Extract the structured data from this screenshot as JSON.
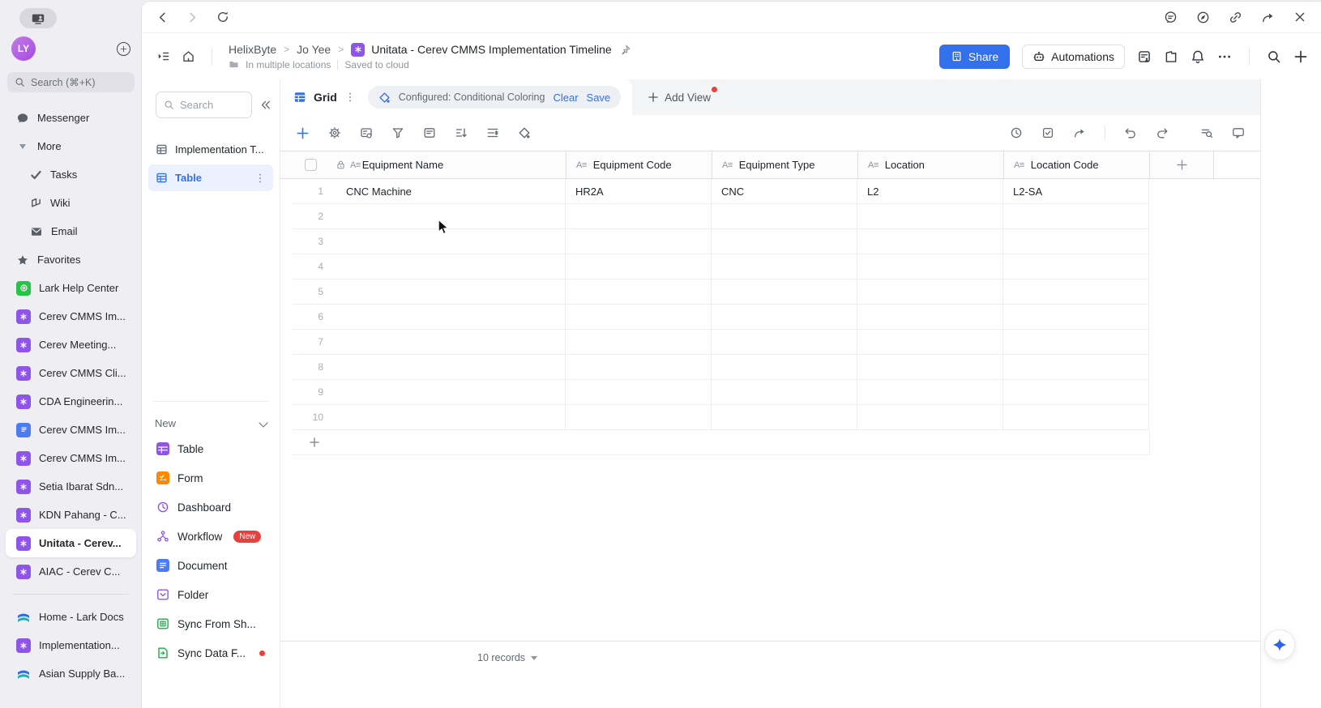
{
  "os_sidebar": {
    "avatar_initials": "LY",
    "search_placeholder": "Search (⌘+K)",
    "messenger_label": "Messenger",
    "more_label": "More",
    "more_subitems": [
      {
        "label": "Tasks",
        "icon": "check-icon"
      },
      {
        "label": "Wiki",
        "icon": "wiki-icon"
      },
      {
        "label": "Email",
        "icon": "mail-icon"
      }
    ],
    "sections": [
      {
        "label": "Favorites",
        "icon": "star-icon",
        "color": "gray"
      },
      {
        "label": "Lark Help Center",
        "icon": "help-icon",
        "color": "green"
      },
      {
        "label": "Cerev CMMS Im...",
        "icon": "base-icon",
        "color": "purple"
      },
      {
        "label": "Cerev Meeting...",
        "icon": "base-icon",
        "color": "purple"
      },
      {
        "label": "Cerev CMMS Cli...",
        "icon": "base-icon",
        "color": "purple"
      },
      {
        "label": "CDA Engineerin...",
        "icon": "doc-icon",
        "color": "purple"
      },
      {
        "label": "Cerev CMMS Im...",
        "icon": "doc-icon",
        "color": "blue"
      },
      {
        "label": "Cerev CMMS Im...",
        "icon": "base-icon",
        "color": "purple"
      },
      {
        "label": "Setia Ibarat Sdn...",
        "icon": "base-icon",
        "color": "purple"
      },
      {
        "label": "KDN Pahang - C...",
        "icon": "base-icon",
        "color": "purple"
      },
      {
        "label": "Unitata - Cerev...",
        "icon": "base-icon",
        "color": "purple",
        "selected": true
      },
      {
        "label": "AIAC - Cerev C...",
        "icon": "base-icon",
        "color": "purple"
      }
    ],
    "footer_items": [
      {
        "label": "Home - Lark Docs",
        "icon": "docs-logo-icon"
      },
      {
        "label": "Implementation...",
        "icon": "base-icon",
        "color": "purple"
      },
      {
        "label": "Asian Supply Ba...",
        "icon": "docs-logo-icon"
      }
    ]
  },
  "panel": {
    "search_placeholder": "Search",
    "items": [
      {
        "label": "Implementation T...",
        "icon": "table-icon",
        "selected": false
      },
      {
        "label": "Table",
        "icon": "table-icon",
        "selected": true
      }
    ],
    "new_label": "New",
    "new_items": [
      {
        "label": "Table",
        "icon": "table-icon",
        "color": "purple"
      },
      {
        "label": "Form",
        "icon": "form-icon",
        "color": "orange"
      },
      {
        "label": "Dashboard",
        "icon": "dashboard-icon",
        "color": "purple"
      },
      {
        "label": "Workflow",
        "icon": "workflow-icon",
        "color": "purple",
        "badge": "New"
      },
      {
        "label": "Document",
        "icon": "document-icon",
        "color": "blue"
      },
      {
        "label": "Folder",
        "icon": "folder-icon",
        "color": "purple"
      },
      {
        "label": "Sync From Sh...",
        "icon": "sync-grid-icon",
        "color": "green"
      },
      {
        "label": "Sync Data F...",
        "icon": "sync-doc-icon",
        "color": "green",
        "dot": true
      }
    ]
  },
  "header": {
    "breadcrumb": [
      "HelixByte",
      "Jo Yee"
    ],
    "separator": ">",
    "title": "Unitata - Cerev CMMS Implementation Timeline",
    "location_note": "In multiple locations",
    "save_status": "Saved to cloud",
    "share_label": "Share",
    "automations_label": "Automations"
  },
  "view_bar": {
    "grid_label": "Grid",
    "config_text": "Configured: Conditional Coloring",
    "clear_label": "Clear",
    "save_label": "Save",
    "add_view_label": "Add View"
  },
  "grid": {
    "field_type_glyph": "A≡",
    "columns": [
      {
        "label": "Equipment Name",
        "locked": true
      },
      {
        "label": "Equipment Code"
      },
      {
        "label": "Equipment Type"
      },
      {
        "label": "Location"
      },
      {
        "label": "Location Code"
      }
    ],
    "rows": [
      {
        "n": "1",
        "c0": "CNC Machine",
        "c1": "HR2A",
        "c2": "CNC",
        "c3": "L2",
        "c4": "L2-SA"
      },
      {
        "n": "2"
      },
      {
        "n": "3"
      },
      {
        "n": "4"
      },
      {
        "n": "5"
      },
      {
        "n": "6"
      },
      {
        "n": "7"
      },
      {
        "n": "8"
      },
      {
        "n": "9"
      },
      {
        "n": "10"
      }
    ],
    "record_count": "10 records"
  },
  "colors": {
    "accent_blue": "#3370EB",
    "base_purple": "#8F55EA",
    "doc_blue": "#4C7CF3",
    "sync_green": "#23A94C",
    "form_orange": "#FF8800",
    "alert_red": "#E8413C"
  }
}
